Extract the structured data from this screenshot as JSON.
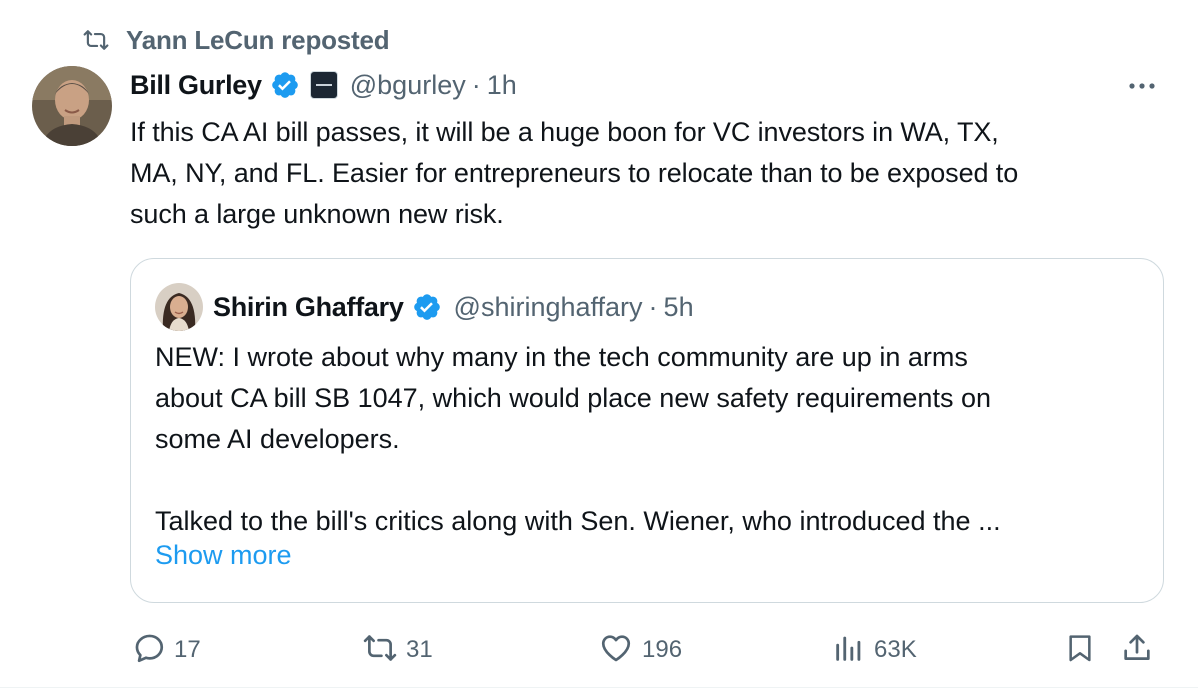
{
  "repost": {
    "icon": "repost-icon",
    "text": "Yann LeCun reposted"
  },
  "tweet": {
    "author_name": "Bill Gurley",
    "handle": "@bgurley",
    "separator": "·",
    "time": "1h",
    "text_lines": [
      "If this CA AI bill passes, it will be a huge boon for VC investors in WA, TX,",
      "MA, NY, and FL. Easier for entrepreneurs to relocate than to be exposed to",
      "such a large unknown new risk."
    ]
  },
  "quote": {
    "author_name": "Shirin Ghaffary",
    "handle": "@shiringhaffary",
    "separator": "·",
    "time": "5h",
    "text_lines": [
      "NEW: I wrote about why many in the tech community are up in arms",
      "about CA bill SB 1047, which would place new safety requirements on",
      "some AI developers.",
      "",
      "Talked to the bill's critics along with Sen. Wiener, who introduced the ..."
    ],
    "show_more": "Show more"
  },
  "actions": {
    "replies": "17",
    "reposts": "31",
    "likes": "196",
    "views": "63K"
  },
  "colors": {
    "text": "#0f1419",
    "secondary": "#536471",
    "link": "#1d9bf0",
    "verified": "#1d9bf0",
    "border": "#cfd9de"
  }
}
